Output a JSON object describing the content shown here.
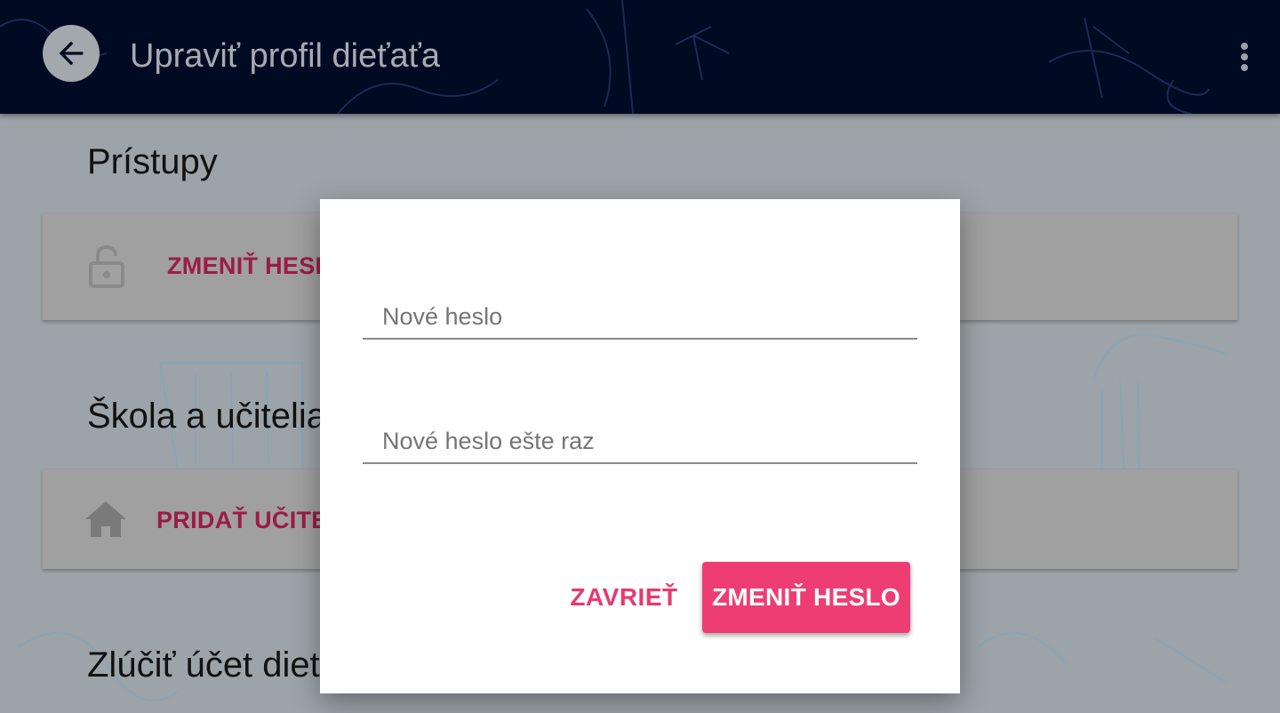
{
  "appbar": {
    "title": "Upraviť profil dieťaťa",
    "back_icon": "arrow-left-icon",
    "more_icon": "more-vert-icon"
  },
  "sections": [
    {
      "title": "Prístupy",
      "card_label": "ZMENIŤ HESLO",
      "card_icon": "lock-open-icon"
    },
    {
      "title": "Škola a učitelia",
      "card_label": "PRIDAŤ UČITEĽA",
      "card_icon": "home-icon"
    },
    {
      "title": "Zlúčiť účet dieťaťa"
    }
  ],
  "dialog": {
    "new_password_placeholder": "Nové heslo",
    "repeat_password_placeholder": "Nové heslo ešte raz",
    "close_label": "ZAVRIEŤ",
    "submit_label": "ZMENIŤ HESLO"
  },
  "colors": {
    "appbar_bg": "#000a22",
    "accent": "#ee3d73",
    "card_label": "#9b1c46"
  }
}
